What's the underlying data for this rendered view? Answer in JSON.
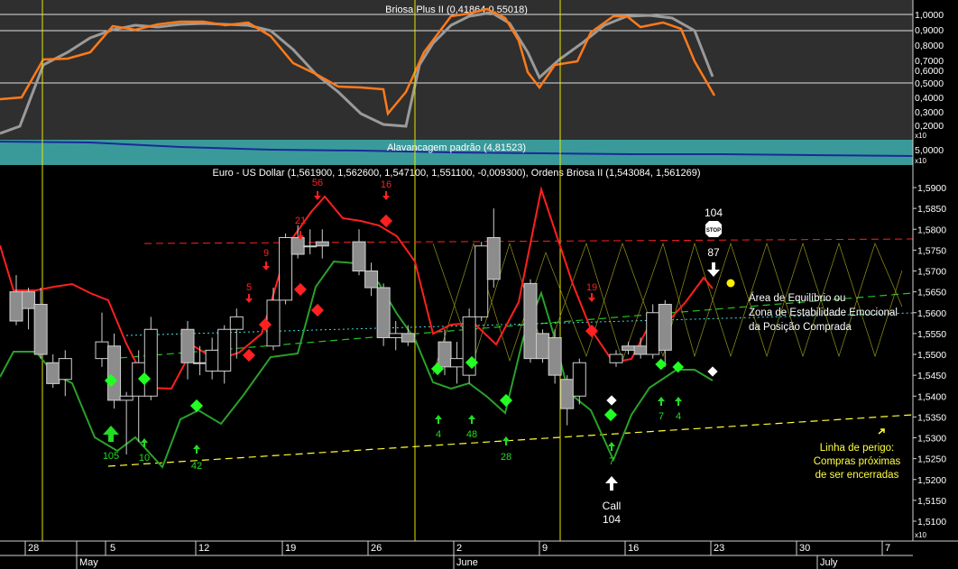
{
  "panels": {
    "oscillator": {
      "title": "Briosa Plus II (0,41864,0,55018)"
    },
    "leverage": {
      "title": "Alavancagem padrão (4,81523)"
    },
    "main": {
      "title": "Euro - US Dollar (1,561900, 1,562600, 1,547100, 1,551100, -0,009300), Ordens Briosa II (1,543084, 1,561269)"
    }
  },
  "labels": {
    "x10_a": "x10",
    "x10_b": "x10",
    "x10_c": "x10",
    "osc_right": [
      "1,0000",
      "0,9000",
      "0,8000",
      "0,7000",
      "0,6000",
      "0,5000",
      "0,4000",
      "0,3000",
      "0,2000"
    ],
    "lev_right": "5,0000",
    "main_right": [
      "1,5900",
      "1,5850",
      "1,5800",
      "1,5750",
      "1,5700",
      "1,5650",
      "1,5600",
      "1,5550",
      "1,5500",
      "1,5450",
      "1,5400",
      "1,5350",
      "1,5300",
      "1,5250",
      "1,5200",
      "1,5150",
      "1,5100"
    ],
    "days": [
      "28",
      "5",
      "12",
      "19",
      "26",
      "2",
      "9",
      "16",
      "23",
      "30",
      "7"
    ],
    "months": [
      "May",
      "June",
      "July"
    ]
  },
  "annotations": {
    "equilibrium": [
      "Área de Equilíbrio ou",
      "Zona de Estabilidade Emocional",
      "da Posição Comprada"
    ],
    "danger": [
      "Linha de perigo:",
      "Compras próximas",
      "de ser encerradas"
    ],
    "call_label": "Call",
    "call_value": "104",
    "stop_top": "104",
    "stop_text": "STOP",
    "stop_bottom": "87",
    "green_counts": [
      "105",
      "10",
      "42",
      "4",
      "48",
      "28",
      "7",
      "7",
      "4"
    ],
    "red_counts": [
      "56",
      "16",
      "21",
      "9",
      "5",
      "19"
    ]
  },
  "colors": {
    "background": "#000000",
    "grid": "#d8d8d8",
    "oscillator_fast": "#ff7a1a",
    "oscillator_slow": "#9a9a9a",
    "leverage_band": "#3a9a9a",
    "leverage_line": "#1a2a9a",
    "upper_line": "#ff2020",
    "lower_line": "#2aa02a",
    "candle_up": "#000000",
    "candle_down": "#8c8c8c",
    "signal_buy": "#22ff22",
    "signal_sell": "#ff2020",
    "annotation_text": "#ffff40",
    "white_text": "#ffffff"
  },
  "chart_data": {
    "type": "candlestick",
    "title": "Euro - US Dollar",
    "ylim": [
      1.507,
      1.5925
    ],
    "x_start": "2008-04-28",
    "candles": [
      {
        "date": "2008-04-28",
        "open": 1.565,
        "high": 1.569,
        "low": 1.557,
        "close": 1.558
      },
      {
        "date": "2008-04-29",
        "open": 1.565,
        "high": 1.566,
        "low": 1.556,
        "close": 1.561
      },
      {
        "date": "2008-04-30",
        "open": 1.562,
        "high": 1.566,
        "low": 1.549,
        "close": 1.55
      },
      {
        "date": "2008-05-01",
        "open": 1.548,
        "high": 1.55,
        "low": 1.542,
        "close": 1.543
      },
      {
        "date": "2008-05-02",
        "open": 1.544,
        "high": 1.551,
        "low": 1.54,
        "close": 1.549
      },
      {
        "date": "2008-05-05",
        "open": 1.549,
        "high": 1.56,
        "low": 1.547,
        "close": 1.553
      },
      {
        "date": "2008-05-06",
        "open": 1.552,
        "high": 1.555,
        "low": 1.537,
        "close": 1.539
      },
      {
        "date": "2008-05-07",
        "open": 1.539,
        "high": 1.541,
        "low": 1.526,
        "close": 1.54
      },
      {
        "date": "2008-05-08",
        "open": 1.54,
        "high": 1.551,
        "low": 1.529,
        "close": 1.548
      },
      {
        "date": "2008-05-09",
        "open": 1.54,
        "high": 1.559,
        "low": 1.539,
        "close": 1.556
      },
      {
        "date": "2008-05-12",
        "open": 1.556,
        "high": 1.558,
        "low": 1.544,
        "close": 1.548
      },
      {
        "date": "2008-05-13",
        "open": 1.548,
        "high": 1.552,
        "low": 1.545,
        "close": 1.548
      },
      {
        "date": "2008-05-14",
        "open": 1.546,
        "high": 1.554,
        "low": 1.544,
        "close": 1.551
      },
      {
        "date": "2008-05-15",
        "open": 1.546,
        "high": 1.557,
        "low": 1.543,
        "close": 1.556
      },
      {
        "date": "2008-05-16",
        "open": 1.556,
        "high": 1.561,
        "low": 1.549,
        "close": 1.559
      },
      {
        "date": "2008-05-19",
        "open": 1.552,
        "high": 1.566,
        "low": 1.551,
        "close": 1.563
      },
      {
        "date": "2008-05-20",
        "open": 1.563,
        "high": 1.579,
        "low": 1.562,
        "close": 1.578
      },
      {
        "date": "2008-05-21",
        "open": 1.578,
        "high": 1.581,
        "low": 1.573,
        "close": 1.574
      },
      {
        "date": "2008-05-22",
        "open": 1.576,
        "high": 1.58,
        "low": 1.574,
        "close": 1.576
      },
      {
        "date": "2008-05-23",
        "open": 1.577,
        "high": 1.58,
        "low": 1.573,
        "close": 1.576
      },
      {
        "date": "2008-05-26",
        "open": 1.577,
        "high": 1.58,
        "low": 1.569,
        "close": 1.57
      },
      {
        "date": "2008-05-27",
        "open": 1.57,
        "high": 1.572,
        "low": 1.564,
        "close": 1.566
      },
      {
        "date": "2008-05-28",
        "open": 1.566,
        "high": 1.567,
        "low": 1.552,
        "close": 1.554
      },
      {
        "date": "2008-05-29",
        "open": 1.554,
        "high": 1.558,
        "low": 1.551,
        "close": 1.555
      },
      {
        "date": "2008-05-30",
        "open": 1.555,
        "high": 1.557,
        "low": 1.552,
        "close": 1.553
      },
      {
        "date": "2008-06-02",
        "open": 1.553,
        "high": 1.556,
        "low": 1.545,
        "close": 1.547
      },
      {
        "date": "2008-06-03",
        "open": 1.547,
        "high": 1.553,
        "low": 1.543,
        "close": 1.549
      },
      {
        "date": "2008-06-04",
        "open": 1.545,
        "high": 1.561,
        "low": 1.543,
        "close": 1.559
      },
      {
        "date": "2008-06-05",
        "open": 1.559,
        "high": 1.577,
        "low": 1.558,
        "close": 1.576
      },
      {
        "date": "2008-06-06",
        "open": 1.578,
        "high": 1.585,
        "low": 1.566,
        "close": 1.568
      },
      {
        "date": "2008-06-09",
        "open": 1.567,
        "high": 1.568,
        "low": 1.548,
        "close": 1.549
      },
      {
        "date": "2008-06-10",
        "open": 1.555,
        "high": 1.556,
        "low": 1.548,
        "close": 1.549
      },
      {
        "date": "2008-06-11",
        "open": 1.554,
        "high": 1.556,
        "low": 1.543,
        "close": 1.545
      },
      {
        "date": "2008-06-12",
        "open": 1.544,
        "high": 1.545,
        "low": 1.533,
        "close": 1.537
      },
      {
        "date": "2008-06-13",
        "open": 1.54,
        "high": 1.549,
        "low": 1.538,
        "close": 1.548
      },
      {
        "date": "2008-06-16",
        "open": 1.548,
        "high": 1.551,
        "low": 1.547,
        "close": 1.55
      },
      {
        "date": "2008-06-17",
        "open": 1.552,
        "high": 1.553,
        "low": 1.55,
        "close": 1.551
      },
      {
        "date": "2008-06-18",
        "open": 1.552,
        "high": 1.554,
        "low": 1.549,
        "close": 1.55
      },
      {
        "date": "2008-06-19",
        "open": 1.55,
        "high": 1.562,
        "low": 1.549,
        "close": 1.56
      },
      {
        "date": "2008-06-20",
        "open": 1.562,
        "high": 1.563,
        "low": 1.547,
        "close": 1.551
      }
    ],
    "levels": {
      "upper_dashed": 1.5705,
      "cyan_dotted": 1.557
    }
  }
}
